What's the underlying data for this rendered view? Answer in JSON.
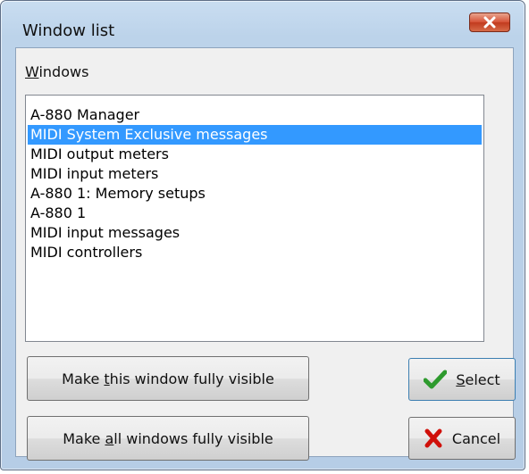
{
  "window": {
    "title": "Window list",
    "close_label": "Close"
  },
  "group": {
    "mnemonic": "W",
    "label_rest": "indows"
  },
  "list": {
    "items": [
      "A-880 Manager",
      "MIDI System Exclusive messages",
      "MIDI output meters",
      "MIDI input meters",
      "A-880 1: Memory setups",
      "A-880 1",
      "MIDI input messages",
      "MIDI controllers"
    ],
    "selected_index": 1
  },
  "buttons": {
    "make_visible": {
      "before": "Make ",
      "mnemonic": "t",
      "after": "his window fully visible"
    },
    "make_all_visible": {
      "before": "Make ",
      "mnemonic": "a",
      "after": "ll windows fully visible"
    },
    "select": {
      "mnemonic": "S",
      "after": "elect",
      "icon": "checkmark-icon"
    },
    "cancel": {
      "text": "Cancel",
      "icon": "red-x-icon"
    }
  },
  "colors": {
    "selection": "#3399ff",
    "check": "#2e9a2e",
    "cancel_x": "#d0100a",
    "close_button": "#c9472b"
  }
}
